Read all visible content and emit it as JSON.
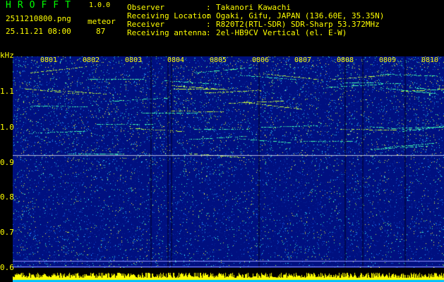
{
  "header": {
    "app_name": "HROFFT",
    "version": "1.0.0",
    "file_name": "2511210800.png",
    "meteor_label": "meteor",
    "date_time": "25.11.21 08:00",
    "meteor_count": "87"
  },
  "station_info": [
    {
      "key": "Observer",
      "value": "Takanori Kawachi"
    },
    {
      "key": "Receiving Location",
      "value": "Ogaki, Gifu, JAPAN (136.60E, 35.35N)"
    },
    {
      "key": "Receiver",
      "value": "R820T2(RTL-SDR) SDR-Sharp 53.372MHz"
    },
    {
      "key": "Receiving antenna",
      "value": "2el-HB9CV Vertical (el. E-W)"
    }
  ],
  "spectrogram": {
    "unit": "kHz",
    "y_ticks": [
      "1.1",
      "1.0",
      "0.9",
      "0.8",
      "0.7",
      "0.6"
    ],
    "y_range_khz": [
      0.6,
      1.2
    ],
    "x_ticks": [
      "0801",
      "0802",
      "0803",
      "0804",
      "0805",
      "0806",
      "0807",
      "0808",
      "0809",
      "0810"
    ],
    "colors": {
      "background": "#001080",
      "noise": "#1a6cff",
      "echo": "#ffff40",
      "carrier_line": "#ffffff",
      "counter": "#ffff00",
      "text": "#ffff00",
      "title": "#00ff00"
    }
  }
}
